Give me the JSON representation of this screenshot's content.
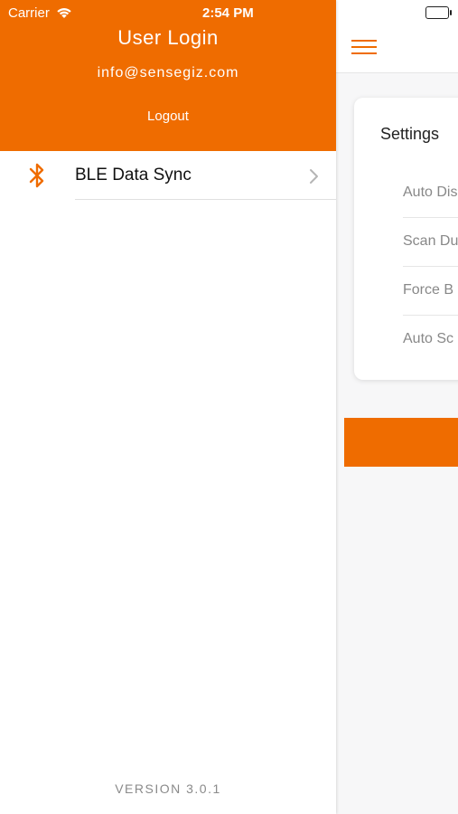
{
  "status_bar": {
    "carrier": "Carrier",
    "time": "2:54 PM"
  },
  "drawer": {
    "header_title": "User Login",
    "email": "info@sensegiz.com",
    "logout_label": "Logout",
    "menu_items": [
      {
        "label": "BLE Data Sync",
        "icon": "bluetooth-icon"
      }
    ],
    "version": "VERSION 3.0.1"
  },
  "settings_card": {
    "title": "Settings",
    "options": [
      "Auto Dis",
      "Scan Du",
      "Force B",
      "Auto Sc"
    ]
  },
  "colors": {
    "accent": "#ef6c00"
  }
}
